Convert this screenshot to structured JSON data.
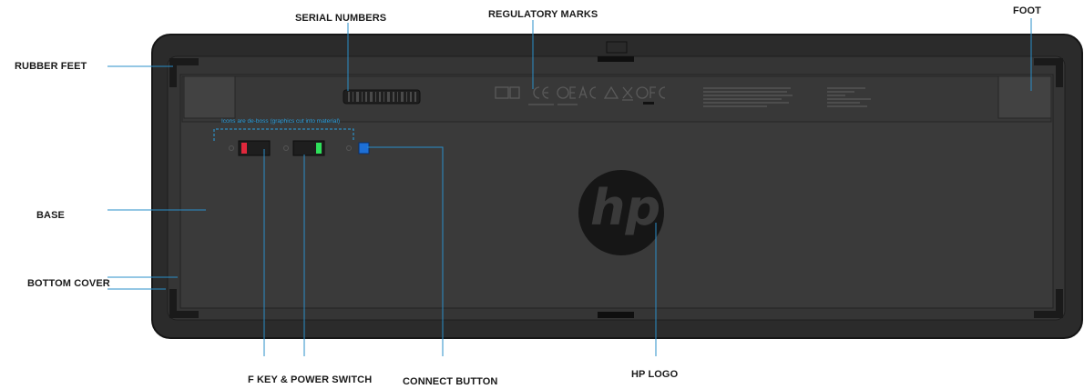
{
  "labels": {
    "serial_numbers": "SERIAL NUMBERS",
    "regulatory_marks": "REGULATORY MARKS",
    "foot": "FOOT",
    "rubber_feet": "RUBBER FEET",
    "base": "BASE",
    "bottom_cover": "BOTTOM COVER",
    "f_key_power_switch": "F KEY & POWER SWITCH",
    "connect_button": "CONNECT BUTTON",
    "hp_logo": "HP LOGO"
  },
  "annotation_note": "Icons are de-boss (graphics cut into material)",
  "logo_text": "hp",
  "colors": {
    "leader_line": "#2a8fc9",
    "body_outer": "#2c2c2c",
    "body_inner": "#3a3a3a",
    "label_strip": "#383838",
    "switch_red": "#e0283c",
    "switch_green": "#2ee05a",
    "connect_blue": "#1d6fd6"
  },
  "icons": [
    "keyboard-bottom-body",
    "hp-logo-icon",
    "ce-mark-icon",
    "fcc-mark-icon",
    "barcode-icon"
  ]
}
